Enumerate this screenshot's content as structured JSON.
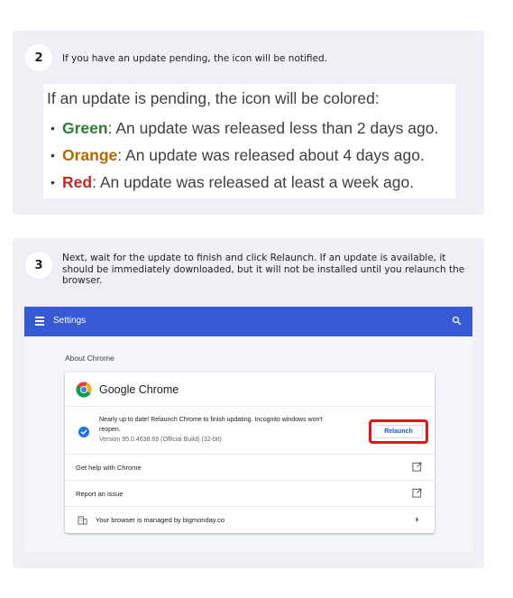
{
  "step2": {
    "number": "2",
    "text": "If you have an update pending, the icon will be notified.",
    "tip": {
      "title": "If an update is pending, the icon will be colored:",
      "items": [
        {
          "keyword": "Green",
          "text": ": An update was released less than 2 days ago.",
          "color": "#2e7d32"
        },
        {
          "keyword": "Orange",
          "text": ": An update was released about 4 days ago.",
          "color": "#b26a00"
        },
        {
          "keyword": "Red",
          "text": ": An update was released at least a week ago.",
          "color": "#c62828"
        }
      ]
    }
  },
  "step3": {
    "number": "3",
    "text": "Next, wait for the update to finish and click Relaunch. If an update is available, it should be immediately downloaded, but it will not be installed until you relaunch the browser."
  },
  "chrome": {
    "appbar_title": "Settings",
    "appbar_color": "#3659d6",
    "section_label": "About Chrome",
    "product_name": "Google Chrome",
    "update_message": "Nearly up to date! Relaunch Chrome to finish updating. Incognito windows won't reopen.",
    "version": "Version 95.0.4638.69 (Official Build) (32-bit)",
    "relaunch_label": "Relaunch",
    "highlight_color": "#e0121a",
    "rows": {
      "help": "Get help with Chrome",
      "report": "Report an issue",
      "managed": "Your browser is managed by bigmonday.co"
    },
    "icons": {
      "menu": "hamburger-menu-icon",
      "search": "search-icon",
      "logo": "chrome-logo-icon",
      "check": "check-circle-icon",
      "external": "external-link-icon",
      "building": "building-icon",
      "chevron": "chevron-right-icon"
    }
  }
}
